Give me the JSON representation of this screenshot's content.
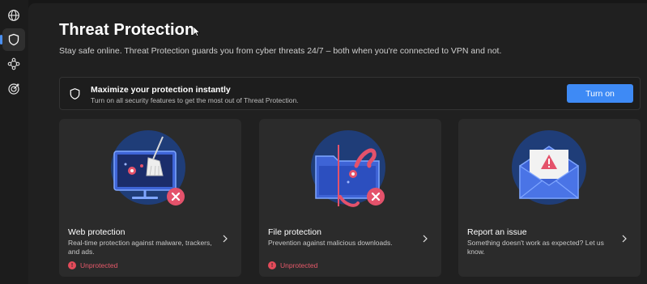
{
  "page": {
    "title": "Threat Protection",
    "subtitle": "Stay safe online. Threat Protection guards you from cyber threats 24/7 – both when you're connected to VPN and not."
  },
  "sidebar": {
    "items": [
      {
        "name": "globe-icon",
        "active": false
      },
      {
        "name": "shield-icon",
        "active": true
      },
      {
        "name": "network-icon",
        "active": false
      },
      {
        "name": "target-icon",
        "active": false
      }
    ]
  },
  "banner": {
    "title": "Maximize your protection instantly",
    "description": "Turn on all security features to get the most out of Threat Protection.",
    "button_label": "Turn on"
  },
  "cards": [
    {
      "title": "Web protection",
      "description": "Real-time protection against malware, trackers, and ads.",
      "status": "Unprotected",
      "illustration": "monitor-broom-illustration"
    },
    {
      "title": "File protection",
      "description": "Prevention against malicious downloads.",
      "status": "Unprotected",
      "illustration": "folder-tentacle-illustration"
    },
    {
      "title": "Report an issue",
      "description": "Something doesn't work as expected? Let us know.",
      "status": "",
      "illustration": "envelope-warning-illustration"
    }
  ],
  "colors": {
    "accent": "#3e8af5",
    "danger": "#e44b5a",
    "card_bg": "#2b2b2b",
    "main_bg": "#202020"
  }
}
